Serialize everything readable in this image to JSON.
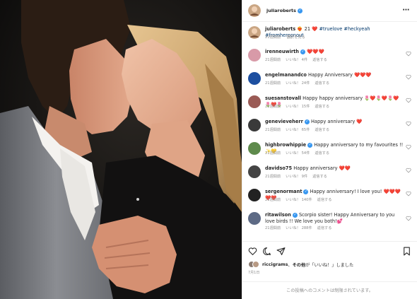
{
  "post": {
    "author": "juliaroberts",
    "more_icon": "ellipsis-icon",
    "caption": {
      "user": "juliaroberts",
      "text": "❤️‍🔥 21 ❤️ ",
      "hashtags": "#truelove #heckyeah #fromhereonout",
      "time": "21週間前",
      "translate": "翻訳を見る"
    },
    "comments": [
      {
        "user": "irenneuwirth",
        "verified": true,
        "text": "❤️❤️❤️",
        "time": "21週間前",
        "likes": "いいね！ 4件",
        "reply": "返信する",
        "avatar_color": "#d89aa8"
      },
      {
        "user": "engelmanandco",
        "verified": false,
        "text": "Happy Anniversary ❤️❤️❤️",
        "time": "21週間前",
        "likes": "いいね！ 24件",
        "reply": "返信する",
        "avatar_color": "#1d4fa0"
      },
      {
        "user": "suesanstovall",
        "verified": false,
        "text": "Happy happy anniversary 🌷❤️🌷❤️🌷❤️🌷❤️🌷",
        "time": "21週間前",
        "likes": "いいね！ 15件",
        "reply": "返信する",
        "avatar_color": "#9a5a55"
      },
      {
        "user": "genevieveherr",
        "verified": true,
        "text": "Happy anniversary ❤️",
        "time": "21週間前",
        "likes": "いいね！ 65件",
        "reply": "返信する",
        "avatar_color": "#3a3a3a"
      },
      {
        "user": "highbrowhippie",
        "verified": true,
        "text": "Happy anniversary to my favourites !! ✨💛",
        "time": "21週間前",
        "likes": "いいね！ 54件",
        "reply": "返信する",
        "avatar_color": "#5e8a4c"
      },
      {
        "user": "davidso75",
        "verified": false,
        "text": "Happy anniversary ❤️❤️",
        "time": "21週間前",
        "likes": "いいね！ 9件",
        "reply": "返信する",
        "avatar_color": "#444444"
      },
      {
        "user": "sergenormant",
        "verified": true,
        "text": "Happy anniversary! I love you! ❤️❤️❤️❤️❤️",
        "time": "21週間前",
        "likes": "いいね！ 140件",
        "reply": "返信する",
        "avatar_color": "#222222"
      },
      {
        "user": "ritawilson",
        "verified": true,
        "text": "Scorpio sister! Happy Anniversary to you love birds !! We love you both!💕",
        "time": "21週間前",
        "likes": "いいね！ 288件",
        "reply": "返信する",
        "avatar_color": "#5d6a85"
      }
    ],
    "actions": {
      "like_icon": "heart-icon",
      "comment_icon": "comment-icon",
      "share_icon": "share-icon",
      "save_icon": "bookmark-icon"
    },
    "likes_summary": {
      "user": "riccigrams",
      "middle": "、",
      "others": "その他",
      "suffix": "が「いいね！」しました"
    },
    "date": "7月1日",
    "comments_disabled": "この投稿へのコメントは制限されています。"
  }
}
